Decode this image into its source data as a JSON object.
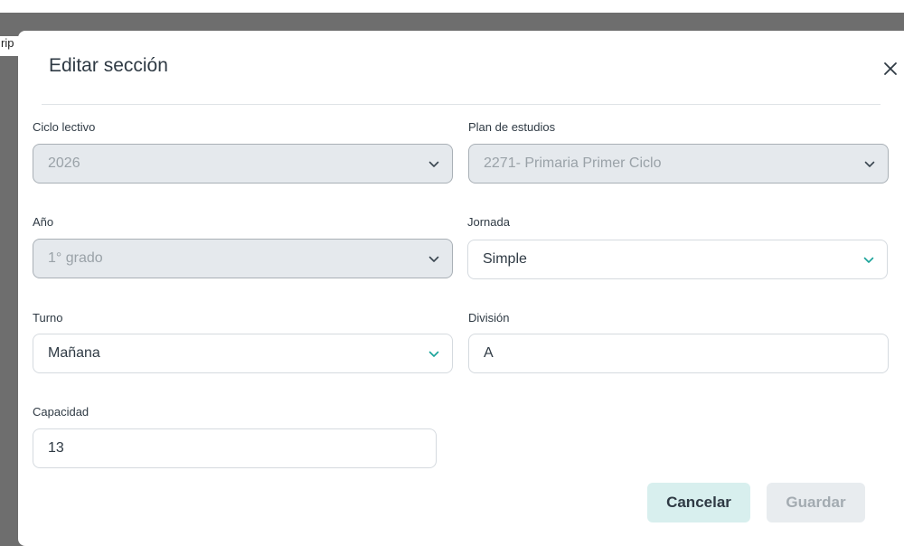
{
  "background": {
    "peek_text": "rip"
  },
  "modal": {
    "title": "Editar sección",
    "close_icon": "close-icon"
  },
  "form": {
    "ciclo": {
      "label": "Ciclo lectivo",
      "value": "2026",
      "disabled": true
    },
    "plan": {
      "label": "Plan de estudios",
      "value": "2271- Primaria Primer Ciclo",
      "disabled": true
    },
    "anio": {
      "label": "Año",
      "value": "1° grado",
      "disabled": true
    },
    "jornada": {
      "label": "Jornada",
      "value": "Simple",
      "disabled": false
    },
    "turno": {
      "label": "Turno",
      "value": "Mañana",
      "disabled": false
    },
    "division": {
      "label": "División",
      "value": "A"
    },
    "capacidad": {
      "label": "Capacidad",
      "value": "13"
    }
  },
  "actions": {
    "cancel_label": "Cancelar",
    "save_label": "Guardar",
    "save_enabled": false
  },
  "colors": {
    "accent": "#1aa39a",
    "disabled_chevron": "#3a4650",
    "cancel_bg": "#d8efee"
  }
}
